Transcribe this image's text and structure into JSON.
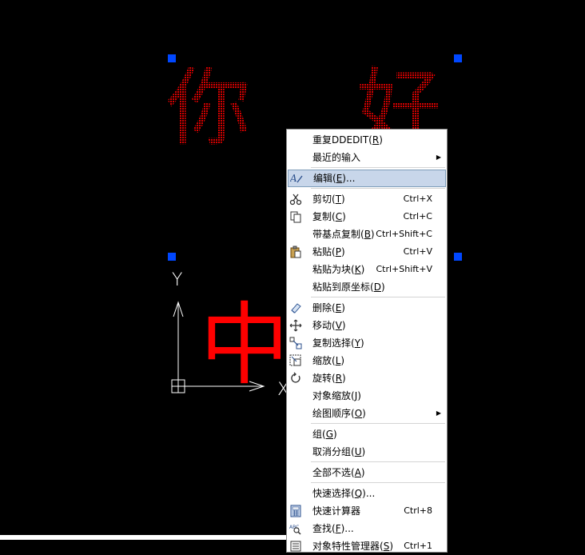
{
  "canvas": {
    "text_top_left": "你",
    "text_top_right": "好",
    "text_middle": "中",
    "ucs_y_label": "Y",
    "ucs_x_label": "X"
  },
  "context_menu": {
    "repeat": {
      "label": "重复DDEDIT(",
      "key": "R",
      "tail": ")"
    },
    "recent_input": {
      "label": "最近的输入"
    },
    "edit": {
      "label": "编辑(",
      "key": "E",
      "tail": ")..."
    },
    "cut": {
      "label": "剪切(",
      "key": "T",
      "tail": ")",
      "shortcut": "Ctrl+X"
    },
    "copy": {
      "label": "复制(",
      "key": "C",
      "tail": ")",
      "shortcut": "Ctrl+C"
    },
    "copy_base": {
      "label": "带基点复制(",
      "key": "B",
      "tail": ")",
      "shortcut": "Ctrl+Shift+C"
    },
    "paste": {
      "label": "粘贴(",
      "key": "P",
      "tail": ")",
      "shortcut": "Ctrl+V"
    },
    "paste_block": {
      "label": "粘贴为块(",
      "key": "K",
      "tail": ")",
      "shortcut": "Ctrl+Shift+V"
    },
    "paste_orig": {
      "label": "粘贴到原坐标(",
      "key": "D",
      "tail": ")"
    },
    "erase": {
      "label": "删除(",
      "key": "E",
      "tail": ")"
    },
    "move": {
      "label": "移动(",
      "key": "V",
      "tail": ")"
    },
    "copy_select": {
      "label": "复制选择(",
      "key": "Y",
      "tail": ")"
    },
    "scale": {
      "label": "缩放(",
      "key": "L",
      "tail": ")"
    },
    "rotate": {
      "label": "旋转(",
      "key": "R",
      "tail": ")"
    },
    "object_scale": {
      "label": "对象缩放(",
      "key": "J",
      "tail": ")"
    },
    "draw_order": {
      "label": "绘图顺序(",
      "key": "O",
      "tail": ")"
    },
    "group": {
      "label": "组(",
      "key": "G",
      "tail": ")"
    },
    "ungroup": {
      "label": "取消分组(",
      "key": "U",
      "tail": ")"
    },
    "deselect_all": {
      "label": "全部不选(",
      "key": "A",
      "tail": ")"
    },
    "quick_select": {
      "label": "快速选择(",
      "key": "Q",
      "tail": ")..."
    },
    "quick_calc": {
      "label": "快速计算器",
      "shortcut": "Ctrl+8"
    },
    "find": {
      "label": "查找(",
      "key": "F",
      "tail": ")..."
    },
    "properties_manager": {
      "label": "对象特性管理器(",
      "key": "S",
      "tail": ")",
      "shortcut": "Ctrl+1"
    }
  },
  "colors": {
    "background": "#000000",
    "text_red": "#ff0000",
    "text_dark_red": "#c80000",
    "grip_blue": "#0047ff",
    "highlight": "#c8d6ea"
  }
}
